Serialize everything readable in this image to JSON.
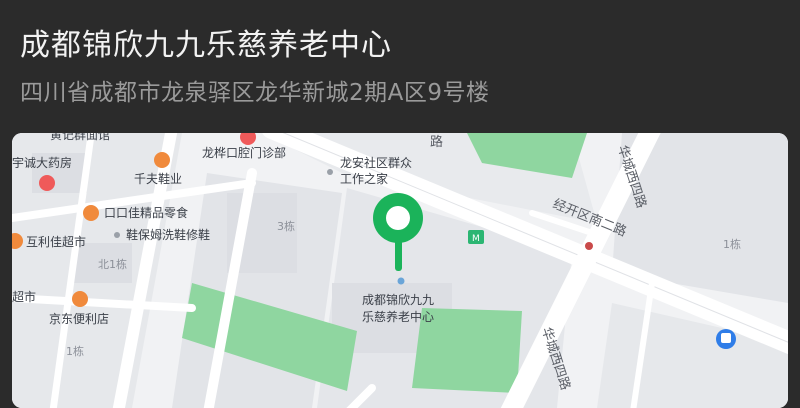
{
  "place": {
    "name": "成都锦欣九九乐慈养老中心",
    "address": "四川省成都市龙泉驿区龙华新城2期A区9号楼"
  },
  "map": {
    "pin_label_line1": "成都锦欣九九",
    "pin_label_line2": "乐慈养老中心",
    "pois": {
      "pharmacy_partial": "宇诚大药房",
      "shoe_shop": "千夫鞋业",
      "clinic": "龙桦口腔门诊部",
      "community_line1": "龙安社区群众",
      "community_line2": "工作之家",
      "food_store": "口口佳精品零食",
      "shoe_repair": "鞋保姆洗鞋修鞋",
      "supermarket_partial": "互利佳超市",
      "jd_store": "京东便利店",
      "market_partial": "超市",
      "top_partial": "黄记群面馆"
    },
    "roads": {
      "road_east": "经开区南二路",
      "road_north": "华城西四路",
      "road_south": "华城西四路",
      "road_top_partial": "路"
    },
    "buildings": {
      "b3": "3栋",
      "b_north1": "北1栋",
      "b1": "1栋",
      "b1_left": "1栋"
    },
    "colors": {
      "pin": "#1bb35a",
      "park": "#8fd6a0",
      "road": "#ffffff",
      "block": "#e1e3e7",
      "water_poi": "#2f7de8"
    }
  }
}
